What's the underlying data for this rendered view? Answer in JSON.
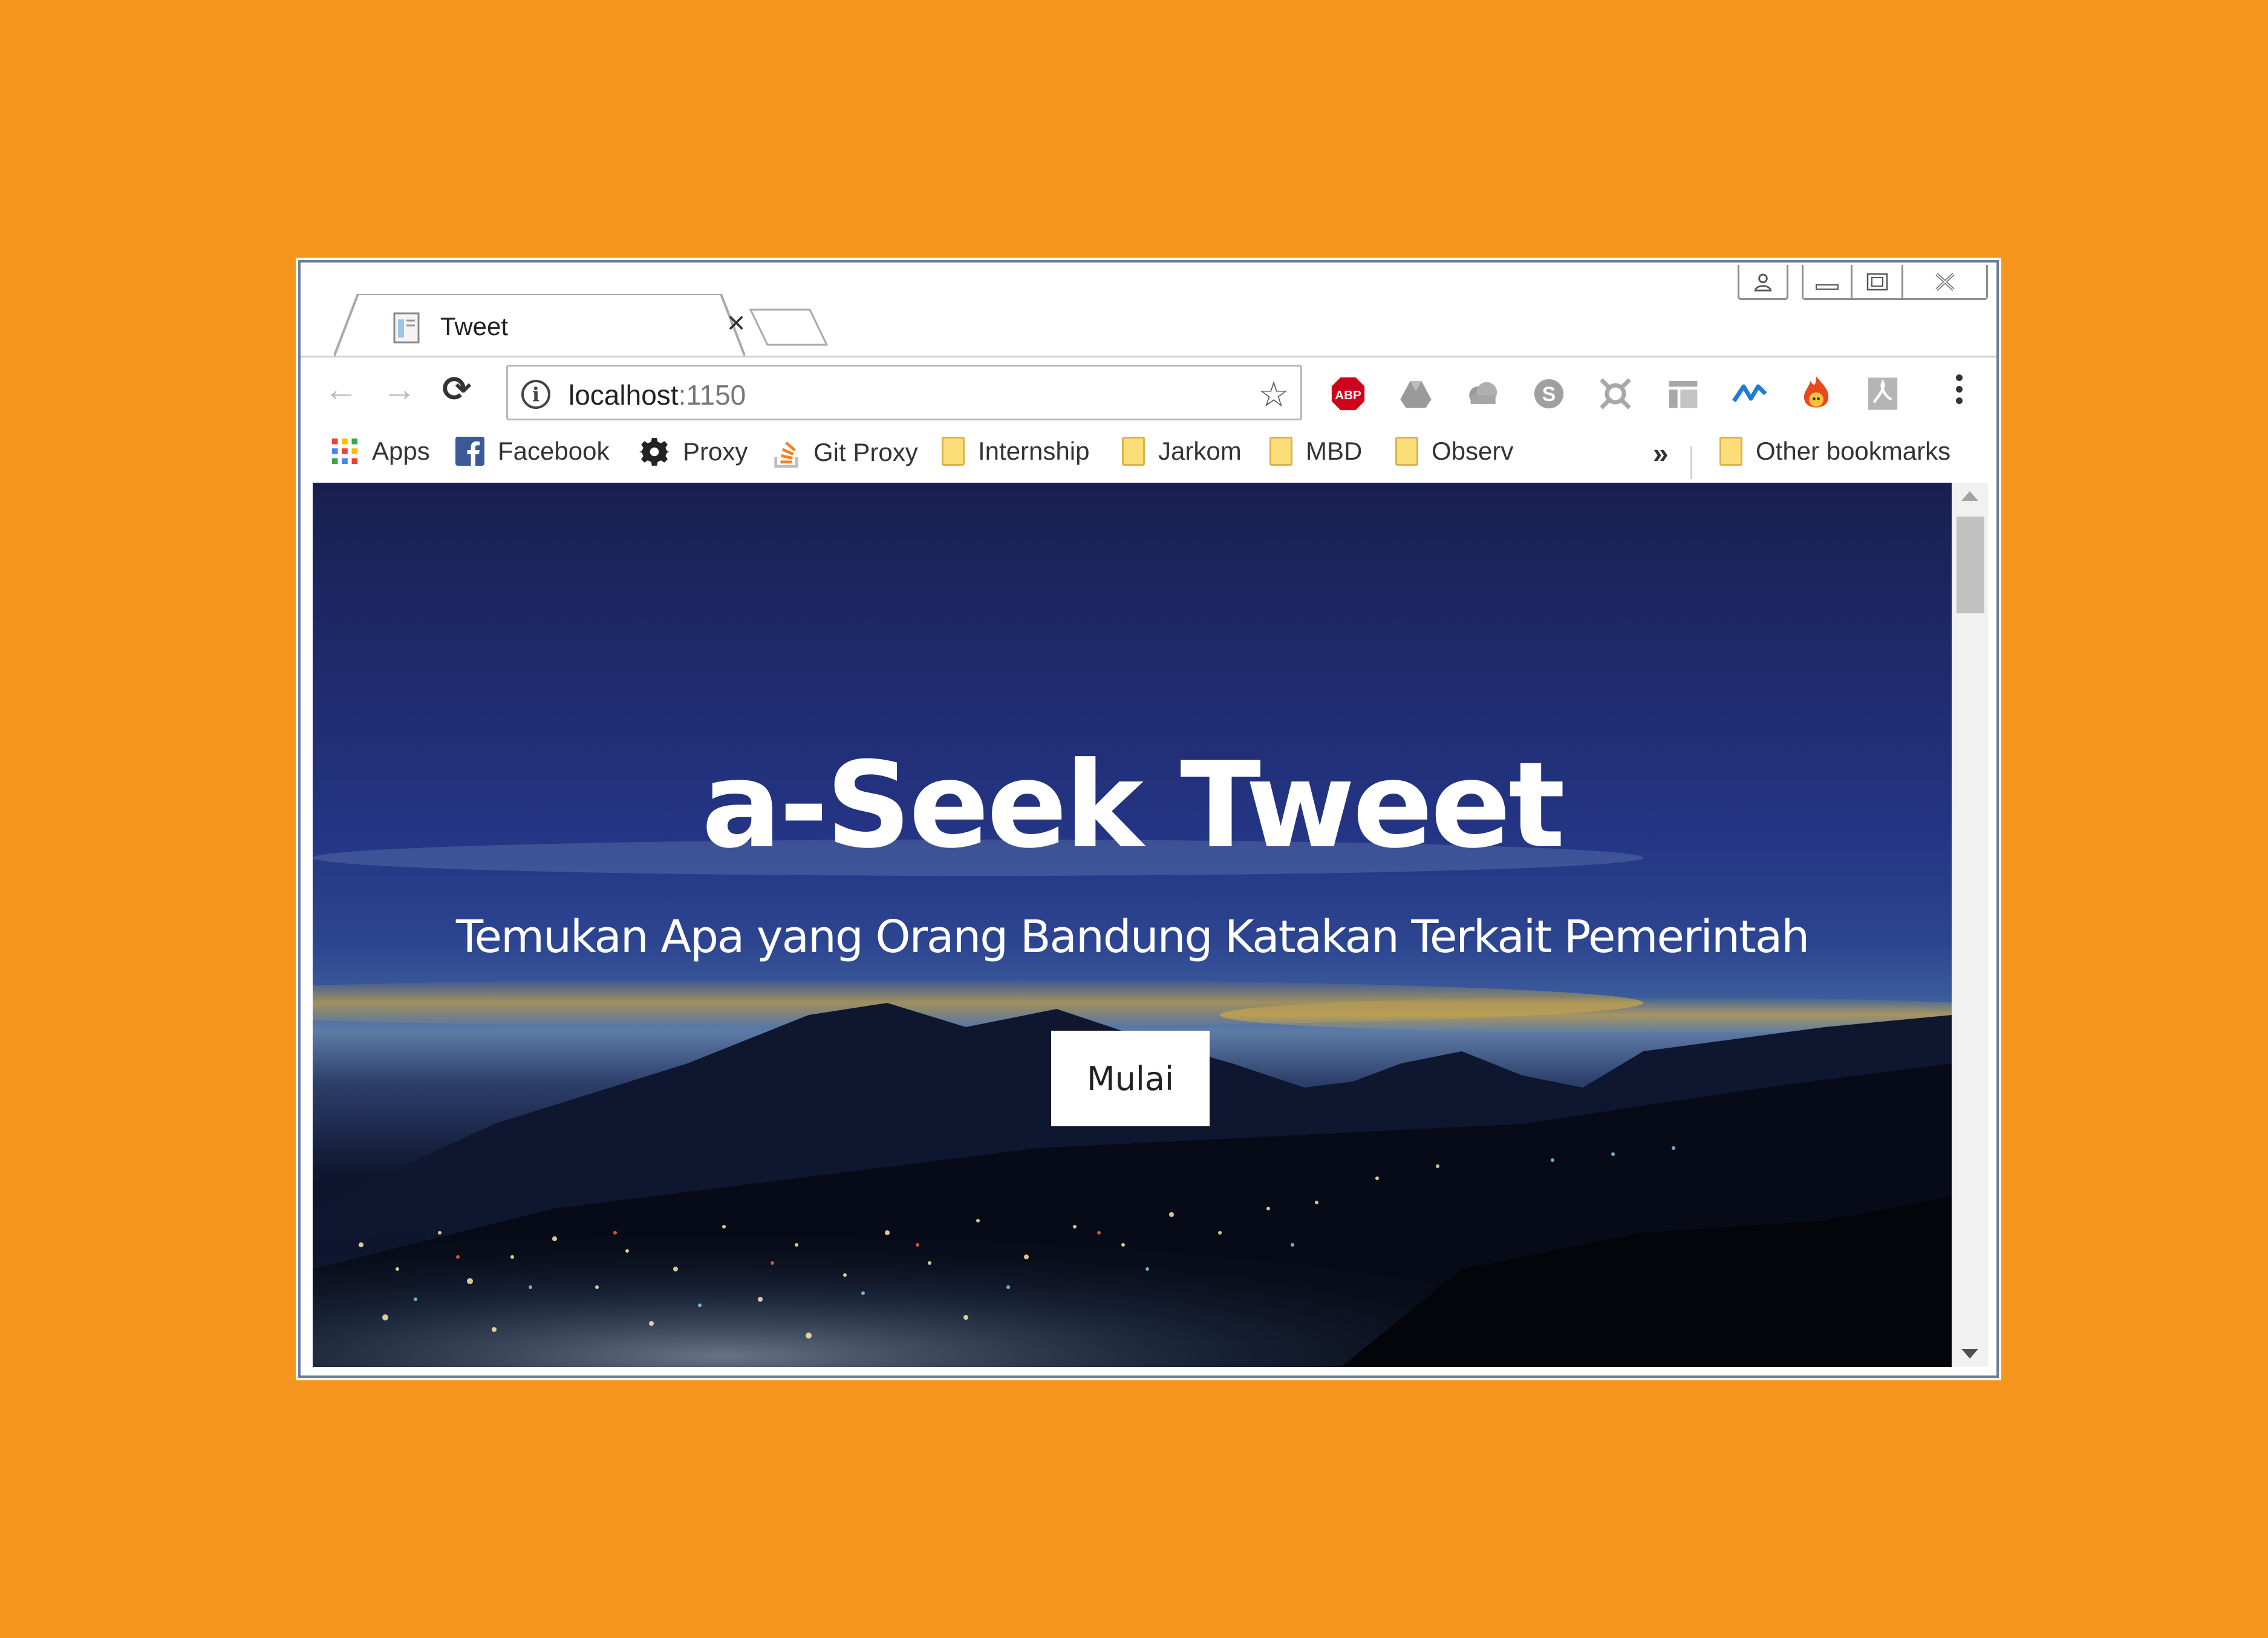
{
  "browser": {
    "tab": {
      "title": "Tweet",
      "close_glyph": "×"
    },
    "window_controls": {
      "profile": "profile-icon",
      "minimize": "minimize-icon",
      "restore": "restore-icon",
      "close": "close-icon"
    },
    "nav": {
      "back": "←",
      "forward": "→",
      "reload": "⟳"
    },
    "address": {
      "host": "localhost",
      "port": ":1150",
      "info_glyph": "i",
      "star": "☆"
    },
    "extensions": [
      "adblock-plus-icon",
      "google-drive-icon",
      "cloud-icon",
      "skype-icon",
      "extension-icon",
      "layout-icon",
      "wave-icon",
      "flame-icon",
      "pdf-icon"
    ],
    "adblock_label": "ABP",
    "bookmarks": {
      "items": [
        {
          "label": "Apps",
          "icon": "apps-grid-icon"
        },
        {
          "label": "Facebook",
          "icon": "facebook-icon"
        },
        {
          "label": "Proxy",
          "icon": "gear-icon"
        },
        {
          "label": "Git Proxy",
          "icon": "stack-icon"
        },
        {
          "label": "Internship",
          "icon": "folder-icon"
        },
        {
          "label": "Jarkom",
          "icon": "folder-icon"
        },
        {
          "label": "MBD",
          "icon": "folder-icon"
        },
        {
          "label": "Observ",
          "icon": "folder-icon"
        }
      ],
      "overflow": "»",
      "other": "Other bookmarks"
    }
  },
  "page": {
    "title": "a-Seek Tweet",
    "subtitle": "Temukan Apa yang Orang Bandung Katakan Terkait Pemerintah",
    "cta": "Mulai"
  },
  "colors": {
    "background": "#F6951E",
    "facebook": "#3B5998",
    "abp": "#D0021B"
  }
}
